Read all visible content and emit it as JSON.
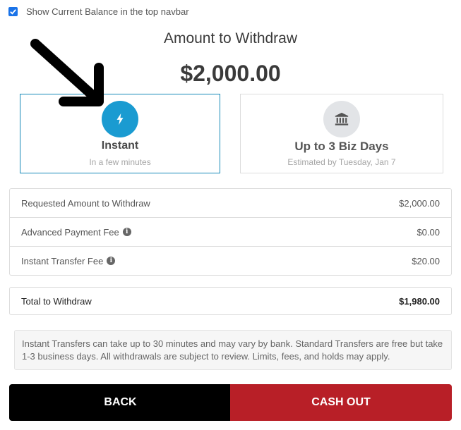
{
  "navbar_option": {
    "label": "Show Current Balance in the top navbar",
    "checked": true
  },
  "title": "Amount to Withdraw",
  "amount": "$2,000.00",
  "options": [
    {
      "title": "Instant",
      "subtitle": "In a few minutes",
      "icon": "lightning-bolt-icon",
      "selected": true
    },
    {
      "title": "Up to 3 Biz Days",
      "subtitle": "Estimated by Tuesday, Jan 7",
      "icon": "bank-icon",
      "selected": false
    }
  ],
  "fees": [
    {
      "label": "Requested Amount to Withdraw",
      "value": "$2,000.00",
      "info": false
    },
    {
      "label": "Advanced Payment Fee",
      "value": "$0.00",
      "info": true
    },
    {
      "label": "Instant Transfer Fee",
      "value": "$20.00",
      "info": true
    }
  ],
  "total": {
    "label": "Total to Withdraw",
    "value": "$1,980.00"
  },
  "note": "Instant Transfers can take up to 30 minutes and may vary by bank. Standard Transfers are free but take 1-3 business days. All withdrawals are subject to review. Limits, fees, and holds may apply.",
  "buttons": {
    "back": "BACK",
    "cash_out": "CASH OUT"
  },
  "colors": {
    "accent": "#1a9bd1",
    "cash_out": "#b81f27",
    "back": "#000000",
    "checkbox": "#1a73e8"
  }
}
